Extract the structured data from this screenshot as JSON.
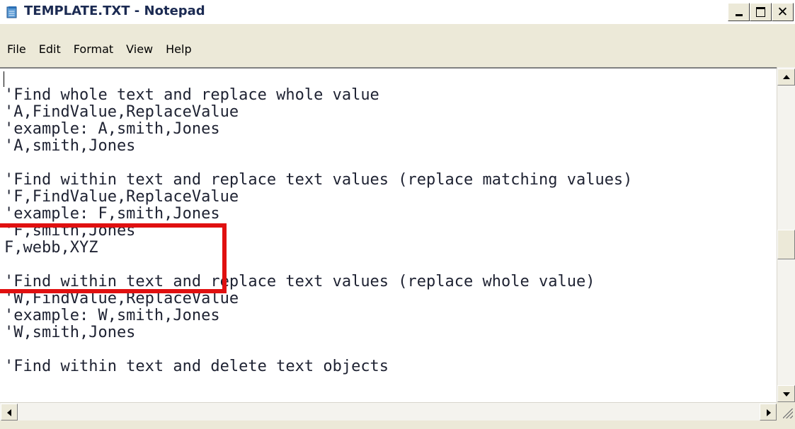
{
  "window": {
    "title": "TEMPLATE.TXT - Notepad",
    "close_glyph": "✕"
  },
  "menu": {
    "file": "File",
    "edit": "Edit",
    "format": "Format",
    "view": "View",
    "help": "Help"
  },
  "document": {
    "lines": [
      "",
      "'Find whole text and replace whole value",
      "'A,FindValue,ReplaceValue",
      "'example: A,smith,Jones",
      "'A,smith,Jones",
      "",
      "'Find within text and replace text values (replace matching values)",
      "'F,FindValue,ReplaceValue",
      "'example: F,smith,Jones",
      "'F,smith,Jones",
      "F,webb,XYZ",
      "",
      "'Find within text and replace text values (replace whole value)",
      "'W,FindValue,ReplaceValue",
      "'example: W,smith,Jones",
      "'W,smith,Jones",
      "",
      "'Find within text and delete text objects"
    ]
  },
  "colors": {
    "highlight": "#e01010",
    "text": "#1e2232",
    "chrome": "#ece9d8"
  },
  "icons": {
    "app": "notepad-icon",
    "minimize": "minimize-icon",
    "maximize": "maximize-icon",
    "close": "close-icon"
  }
}
